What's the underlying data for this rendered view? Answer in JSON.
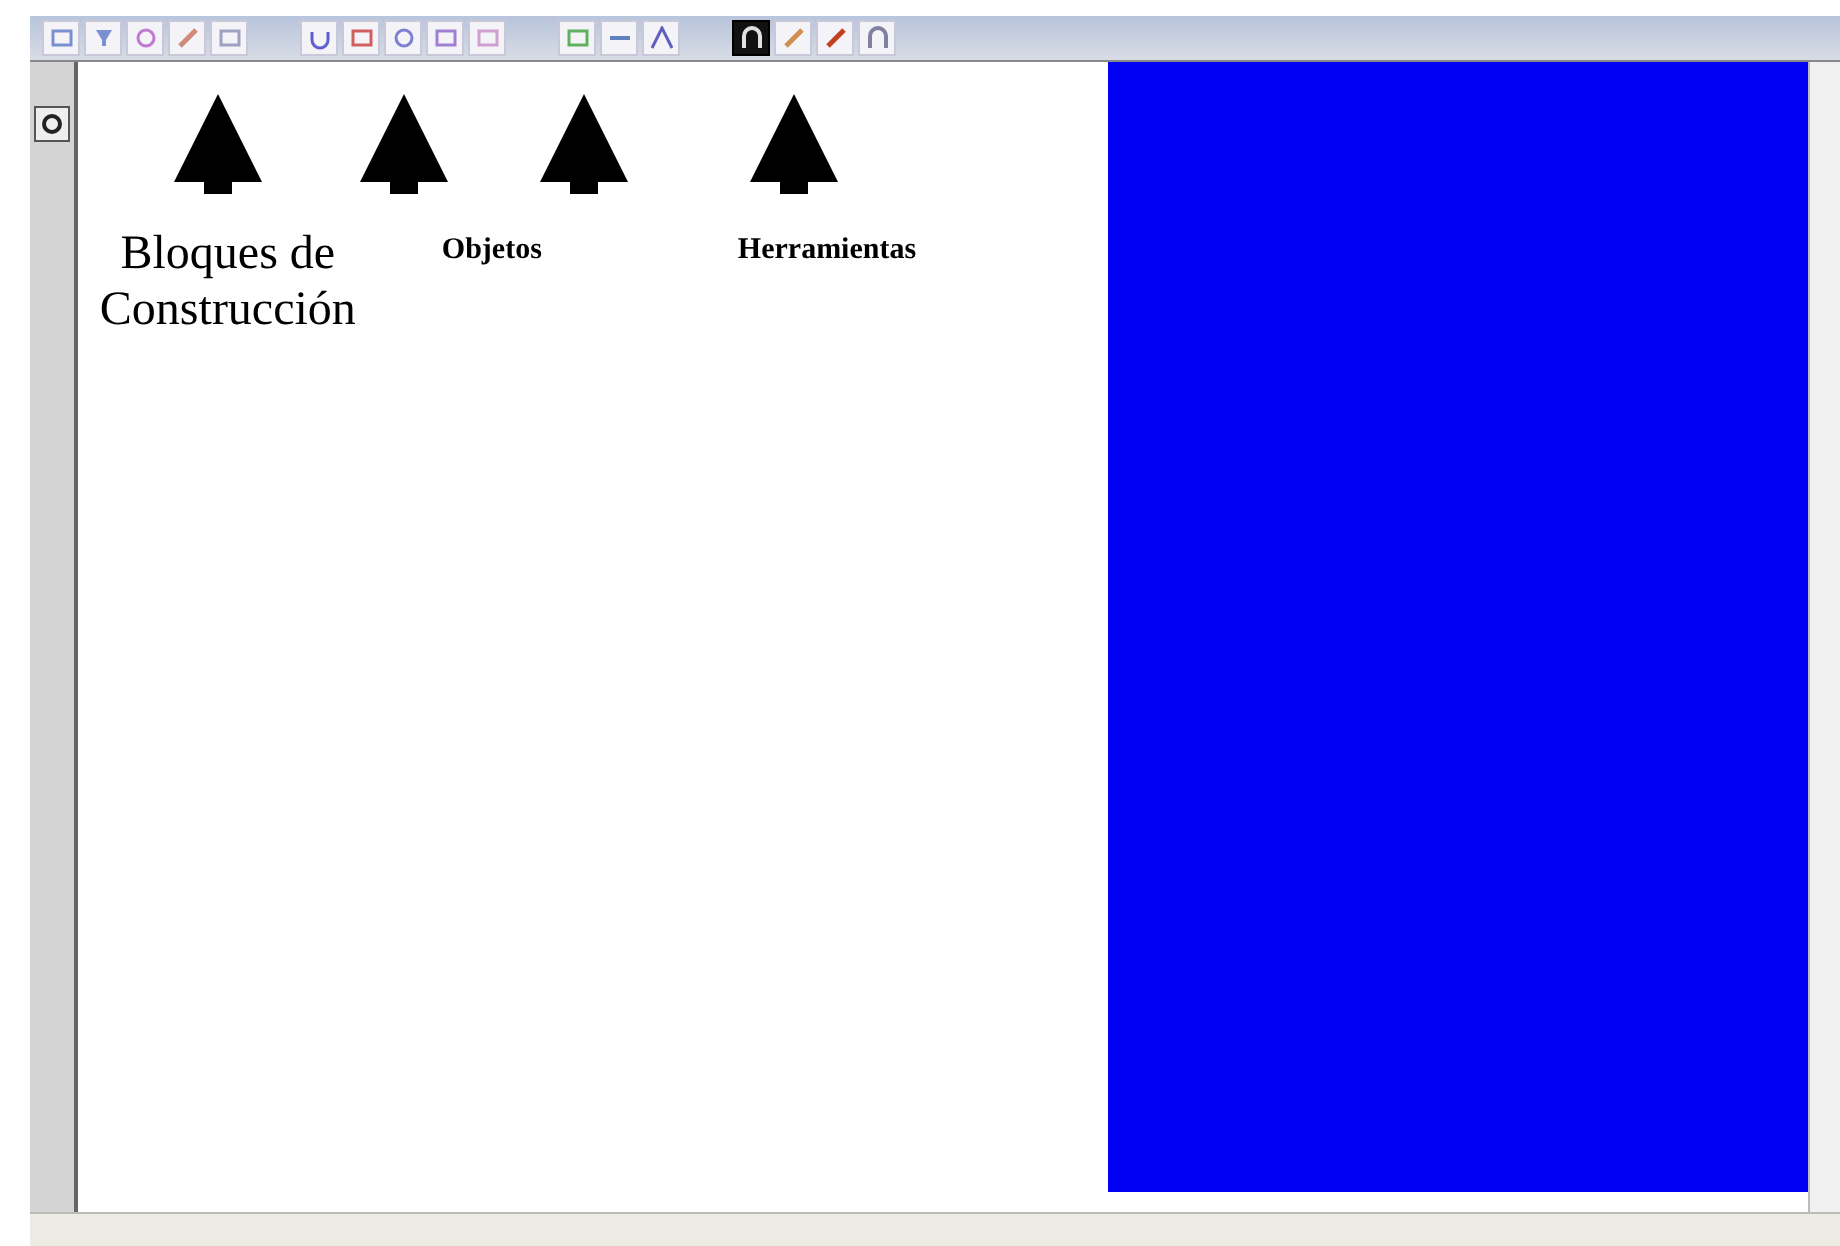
{
  "toolbar": {
    "buttons": [
      {
        "selected": false
      },
      {
        "selected": false
      },
      {
        "selected": false
      },
      {
        "selected": false
      },
      {
        "selected": false
      },
      {
        "selected": false
      },
      {
        "selected": false
      },
      {
        "selected": false
      },
      {
        "selected": false
      },
      {
        "selected": false
      },
      {
        "selected": false
      },
      {
        "selected": false
      },
      {
        "selected": false
      },
      {
        "selected": true
      },
      {
        "selected": false
      },
      {
        "selected": false
      },
      {
        "selected": false
      }
    ]
  },
  "annotations": [
    {
      "label": "Bloques de Construcción"
    },
    {
      "label": "Objetos"
    },
    {
      "label": "Herramientas"
    }
  ]
}
